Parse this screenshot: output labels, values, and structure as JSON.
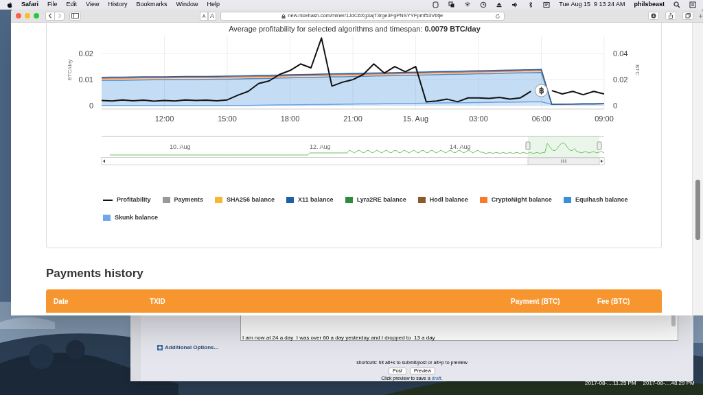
{
  "menu_bar": {
    "items": [
      {
        "label": "Safari",
        "kind": "app"
      },
      {
        "label": "File",
        "kind": "menu"
      },
      {
        "label": "Edit",
        "kind": "menu"
      },
      {
        "label": "View",
        "kind": "menu"
      },
      {
        "label": "History",
        "kind": "menu"
      },
      {
        "label": "Bookmarks",
        "kind": "menu"
      },
      {
        "label": "Window",
        "kind": "menu"
      },
      {
        "label": "Help",
        "kind": "menu"
      }
    ],
    "clock": "Tue Aug 15  9 13 24 AM",
    "user": "philsbeast"
  },
  "browser": {
    "text_size_buttons": [
      "A",
      "A"
    ],
    "address": "new.nicehash.com/miner/1JdC6Xg3ajT3rge3FgPNSYYFpmf53Vbtje",
    "new_tab": "+"
  },
  "chart_card": {
    "title": "Average profitability for selected algorithms and timespan: **0.0079 BTC/day**",
    "chart_data": {
      "type": "area",
      "stacked": true,
      "grid": true,
      "ylabel": "BTC/day",
      "y2label": "BTC",
      "ylim": [
        -0.0013,
        0.029
      ],
      "y2lim": [
        -0.0026,
        0.058
      ],
      "yticks": [
        0,
        0.01,
        0.02
      ],
      "y2ticks": [
        0,
        0.02,
        0.04
      ],
      "categories": [
        null,
        null,
        null,
        null,
        null,
        null,
        "12:00",
        null,
        null,
        null,
        null,
        null,
        "15:00",
        null,
        null,
        null,
        null,
        null,
        "18:00",
        null,
        null,
        null,
        null,
        null,
        "21:00",
        null,
        null,
        null,
        null,
        null,
        "15. Aug",
        null,
        null,
        null,
        null,
        null,
        "03:00",
        null,
        null,
        null,
        null,
        null,
        "06:00",
        null,
        null,
        null,
        null,
        null,
        "09:00"
      ],
      "series": [
        {
          "name": "Skunk balance",
          "color": "#6fa8e8",
          "type": "area",
          "axis": "y2",
          "values": [
            0,
            0,
            0,
            0,
            0,
            0,
            0,
            0,
            0,
            0,
            0,
            0,
            0,
            0.0001,
            0.0002,
            0.0003,
            0.0004,
            0.0005,
            0.0006,
            0.0007,
            0.0008,
            0.0009,
            0.001,
            0.0011,
            0.0012,
            0.0013,
            0.0014,
            0.0015,
            0.0016,
            0.0017,
            0.0018,
            0.0019,
            0.002,
            0.0021,
            0.0022,
            0.0023,
            0.0024,
            0.0025,
            0.0026,
            0.0027,
            0.0028,
            0.0029,
            0.003,
            0.001,
            0.0011,
            0.0012,
            0.0013,
            0.0014,
            0.0015
          ]
        },
        {
          "name": "Equihash balance",
          "color": "#3a8fd9",
          "type": "area",
          "axis": "y2",
          "values": [
            0.0195,
            0.0196,
            0.0196,
            0.0197,
            0.0198,
            0.0199,
            0.0199,
            0.02,
            0.0201,
            0.0201,
            0.0202,
            0.0203,
            0.0204,
            0.0204,
            0.0205,
            0.0206,
            0.0206,
            0.0207,
            0.0208,
            0.0209,
            0.0209,
            0.021,
            0.0211,
            0.0211,
            0.0212,
            0.0213,
            0.0214,
            0.0214,
            0.0215,
            0.0216,
            0.0216,
            0.0217,
            0.0218,
            0.0219,
            0.0219,
            0.022,
            0.0221,
            0.0221,
            0.0222,
            0.0223,
            0.0224,
            0.0224,
            0.0225,
            0,
            0,
            0,
            0,
            0,
            0
          ]
        },
        {
          "name": "CryptoNight balance",
          "color": "#f97a2b",
          "type": "area",
          "axis": "y2",
          "values": [
            0.0015,
            0.0015,
            0.0015,
            0.0015,
            0.0015,
            0.0015,
            0.0015,
            0.0015,
            0.0015,
            0.0015,
            0.0015,
            0.0015,
            0.0015,
            0.0015,
            0.0015,
            0.0015,
            0.0015,
            0.0015,
            0.0015,
            0.0015,
            0.0015,
            0.0015,
            0.0015,
            0.0015,
            0.0015,
            0.0015,
            0.0015,
            0.0015,
            0.0015,
            0.0015,
            0.0015,
            0.0015,
            0.0015,
            0.0015,
            0.0015,
            0.0015,
            0.0015,
            0.0015,
            0.0015,
            0.0015,
            0.0015,
            0.0015,
            0.0015,
            0,
            0,
            0,
            0,
            0,
            0
          ]
        },
        {
          "name": "X11 balance",
          "color": "#1f5fa8",
          "type": "area",
          "axis": "y2",
          "values": [
            0.0008,
            0.0008,
            0.0008,
            0.0008,
            0.0008,
            0.0008,
            0.0008,
            0.0008,
            0.0008,
            0.0008,
            0.0008,
            0.0008,
            0.0008,
            0.0008,
            0.0008,
            0.0008,
            0.0008,
            0.0008,
            0.0008,
            0.0008,
            0.0008,
            0.0008,
            0.0008,
            0.0008,
            0.0008,
            0.0008,
            0.0008,
            0.0008,
            0.0008,
            0.0008,
            0.0008,
            0.0008,
            0.0008,
            0.0008,
            0.0008,
            0.0008,
            0.0008,
            0.0008,
            0.0008,
            0.0008,
            0.0008,
            0.0008,
            0.0008,
            0,
            0,
            0,
            0,
            0,
            0
          ]
        },
        {
          "name": "Profitability",
          "color": "#111111",
          "type": "line",
          "values": [
            0.002,
            0.0018,
            0.0022,
            0.0019,
            0.0021,
            0.0017,
            0.002,
            0.0018,
            0.0022,
            0.002,
            0.0021,
            0.0019,
            0.0022,
            0.004,
            0.0055,
            0.0085,
            0.0095,
            0.012,
            0.0135,
            0.016,
            0.0145,
            0.026,
            0.0075,
            0.009,
            0.01,
            0.012,
            0.016,
            0.0125,
            0.015,
            0.013,
            0.015,
            0.0015,
            0.0018,
            0.0025,
            0.0015,
            0.003,
            0.003,
            0.0028,
            0.0032,
            0.0025,
            0.003,
            0.0055,
            null,
            0.0058,
            0.0045,
            0.0055,
            0.0042,
            0.0055,
            0.0045
          ]
        }
      ],
      "annotations": [
        {
          "x": "06:00",
          "y": 0.0058,
          "text": "฿"
        }
      ]
    },
    "navigator": {
      "labels": [
        "10. Aug",
        "12. Aug",
        "14. Aug"
      ]
    },
    "legend": [
      {
        "label": "Payments",
        "color": "#999999"
      },
      {
        "label": "SHA256 balance",
        "color": "#f7b731"
      },
      {
        "label": "Lyra2RE balance",
        "color": "#2e8b3e"
      },
      {
        "label": "Hodl balance",
        "color": "#8b5a2b"
      }
    ]
  },
  "payments": {
    "heading": "Payments history",
    "table": {
      "columns": [
        "Date",
        "TXID",
        "Payment (BTC)",
        "Fee (BTC)"
      ]
    }
  },
  "forum_window": {
    "message": "I am now at 24 a day  I was over 60 a day yesterday and I dropped to  13 a day",
    "additional_options": "Additional Options...",
    "shortcuts": "shortcuts: hit alt+s to submit/post or alt+p to preview",
    "buttons": [
      "Post",
      "Preview"
    ],
    "save_note": "Click preview to save a",
    "draft_link": "draft",
    "save_note_end": "."
  },
  "desktop": {
    "files": [
      "2017-08-....11.25 PM",
      "2017-08-....48.29 PM"
    ]
  }
}
